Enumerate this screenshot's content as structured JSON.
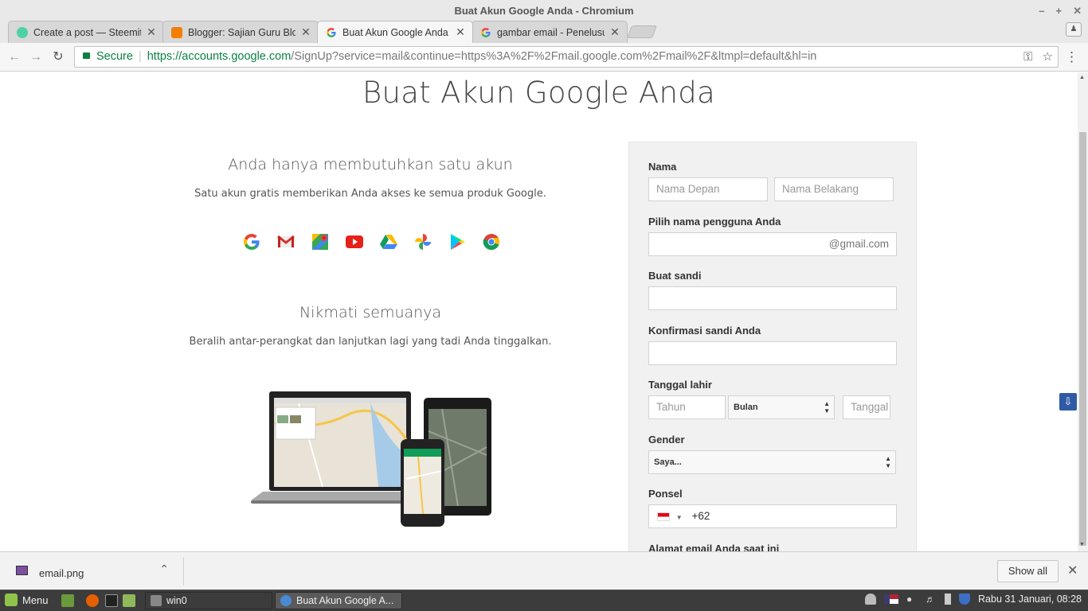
{
  "window": {
    "title": "Buat Akun Google Anda - Chromium",
    "minimize": "–",
    "maximize": "+",
    "close": "✕"
  },
  "tabs": [
    {
      "title": "Create a post — Steemit",
      "close": "✕",
      "favicon": "steemit-icon"
    },
    {
      "title": "Blogger: Sajian Guru Blog",
      "close": "✕",
      "favicon": "blogger-icon"
    },
    {
      "title": "Buat Akun Google Anda",
      "close": "✕",
      "favicon": "google-icon"
    },
    {
      "title": "gambar email - Penelusuran Google",
      "close": "✕",
      "favicon": "google-icon"
    }
  ],
  "toolbar": {
    "back": "←",
    "forward": "→",
    "reload": "↻",
    "secure_label": "Secure",
    "url_scheme_host": "https://accounts.google.com",
    "url_path": "/SignUp?service=mail&continue=https%3A%2F%2Fmail.google.com%2Fmail%2F&ltmpl=default&hl=in",
    "key_icon": "⚿",
    "star_icon": "☆",
    "menu_icon": "⋮"
  },
  "page": {
    "title": "Buat Akun Google Anda",
    "left": {
      "heading1": "Anda hanya membutuhkan satu akun",
      "text1": "Satu akun gratis memberikan Anda akses ke semua produk Google.",
      "heading2": "Nikmati semuanya",
      "text2": "Beralih antar-perangkat dan lanjutkan lagi yang tadi Anda tinggalkan.",
      "apps": [
        "google",
        "gmail",
        "maps",
        "youtube",
        "drive",
        "photos",
        "play",
        "chrome"
      ]
    },
    "form": {
      "name_label": "Nama",
      "first_name_placeholder": "Nama Depan",
      "last_name_placeholder": "Nama Belakang",
      "username_label": "Pilih nama pengguna Anda",
      "username_suffix": "@gmail.com",
      "password_label": "Buat sandi",
      "confirm_label": "Konfirmasi sandi Anda",
      "birthday_label": "Tanggal lahir",
      "year_placeholder": "Tahun",
      "month_value": "Bulan",
      "day_placeholder": "Tanggal",
      "gender_label": "Gender",
      "gender_value": "Saya...",
      "phone_label": "Ponsel",
      "phone_code": "+62",
      "email_label": "Alamat email Anda saat ini"
    }
  },
  "downloads": {
    "file_name": "email.png",
    "chevron": "⌃",
    "show_all": "Show all",
    "close": "✕"
  },
  "taskbar": {
    "menu_label": "Menu",
    "windows": [
      "win0",
      "Buat Akun Google A..."
    ],
    "clock": "Rabu 31 Januari, 08:28"
  },
  "colors": {
    "secure_green": "#0b8043",
    "form_bg": "#f1f1f1",
    "taskbar_bg": "#3c3c3c"
  }
}
